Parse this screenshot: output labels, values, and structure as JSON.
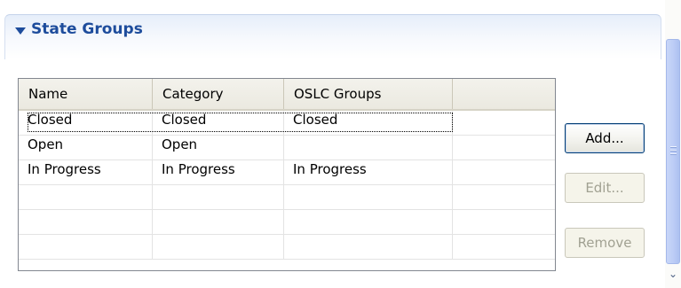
{
  "section": {
    "title": "State Groups",
    "expanded": true
  },
  "table": {
    "columns": [
      "Name",
      "Category",
      "OSLC Groups",
      ""
    ],
    "rows": [
      [
        "Closed",
        "Closed",
        "Closed",
        ""
      ],
      [
        "Open",
        "Open",
        "",
        ""
      ],
      [
        "In Progress",
        "In Progress",
        "In Progress",
        ""
      ],
      [
        "",
        "",
        "",
        ""
      ],
      [
        "",
        "",
        "",
        ""
      ],
      [
        "",
        "",
        "",
        ""
      ]
    ],
    "focused_row": 0
  },
  "buttons": {
    "add": {
      "label": "Add...",
      "enabled": true
    },
    "edit": {
      "label": "Edit...",
      "enabled": false
    },
    "remove": {
      "label": "Remove",
      "enabled": false
    }
  },
  "scrollbar": {
    "down_arrow_icon": "chevron-down-icon"
  }
}
